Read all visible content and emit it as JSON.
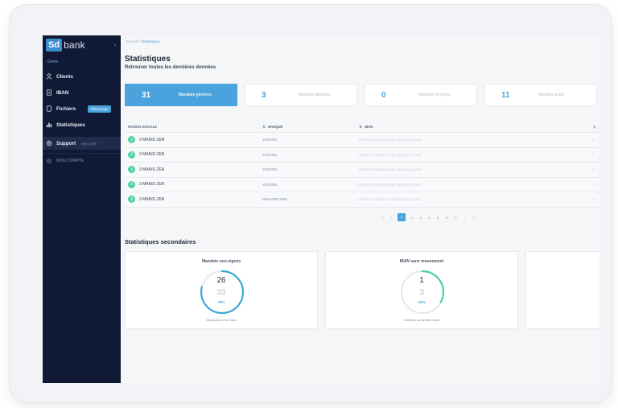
{
  "sidebar": {
    "logo_box": "Sd",
    "logo_text": "bank",
    "collapse": "‹",
    "section_label": "Demo",
    "items": [
      {
        "label": "Clients"
      },
      {
        "label": "IBAN"
      },
      {
        "label": "Fichiers",
        "badge": "Télécharger"
      },
      {
        "label": "Statistiques"
      },
      {
        "label": "Support",
        "sub": "Mon profil"
      },
      {
        "label": "MON COMPTE"
      }
    ]
  },
  "breadcrumb": {
    "root": "Accueil",
    "sep": "/",
    "current": "Statistiques"
  },
  "page": {
    "title": "Statistiques",
    "subtitle": "Retrouver toutes les dernières données"
  },
  "stats": [
    {
      "value": "31",
      "label": "Mandats générés"
    },
    {
      "value": "3",
      "label": "Mandats déposés"
    },
    {
      "value": "0",
      "label": "Mandats envoyés"
    },
    {
      "value": "11",
      "label": "Mandats actifs"
    }
  ],
  "table": {
    "headers": [
      "RAISON SOCIALE",
      "BANQUE",
      "IBAN"
    ],
    "sort_glyph": "⇅",
    "rows": [
      {
        "avatar": "3",
        "name": "3 MAINS ZEN",
        "bank": "YAGOON",
        "iban": "FR76 1673 8000 0190 0000 4213 000",
        "end": "›"
      },
      {
        "avatar": "3",
        "name": "3 MAINS ZEN",
        "bank": "YAGOON",
        "iban": "FR76 1673 8000 0190 0000 4213 000",
        "end": "›"
      },
      {
        "avatar": "3",
        "name": "3 MAINS ZEN",
        "bank": "YAGOON",
        "iban": "FR76 1673 8000 0190 0000 4213 000",
        "end": "›"
      },
      {
        "avatar": "3",
        "name": "3 MAINS ZEN",
        "bank": "YAGOON",
        "iban": "FR76 1673 8000 0190 0000 4213 000",
        "end": "›"
      },
      {
        "avatar": "3",
        "name": "3 MAINS ZEN",
        "bank": "MANAGER BNK",
        "iban": "FR76 1673 8000 0190 0000 4213 000",
        "end": "›"
      }
    ]
  },
  "pager": {
    "first": "«",
    "prev": "‹",
    "next": "›",
    "last": "»",
    "pages": [
      "1",
      "2",
      "3",
      "4",
      "5",
      "6",
      "7"
    ],
    "current_index": 0
  },
  "secondary": {
    "title": "Statistiques secondaires",
    "cards": [
      {
        "title": "Mandats non-signés",
        "value": "26",
        "total": "33",
        "percent_label": "79%",
        "fraction": 0.79,
        "footer": "Dépassées d'un mois",
        "color": "#3aa9d8"
      },
      {
        "title": "IBAN sans mouvement",
        "value": "1",
        "total": "3",
        "percent_label": "33%",
        "fraction": 0.33,
        "footer": "Inférieur au dernier mois",
        "color": "#4cd1a3"
      }
    ]
  },
  "colors": {
    "accent": "#4aa3dc",
    "sidebar": "#101a36",
    "success": "#4cd1a3"
  }
}
